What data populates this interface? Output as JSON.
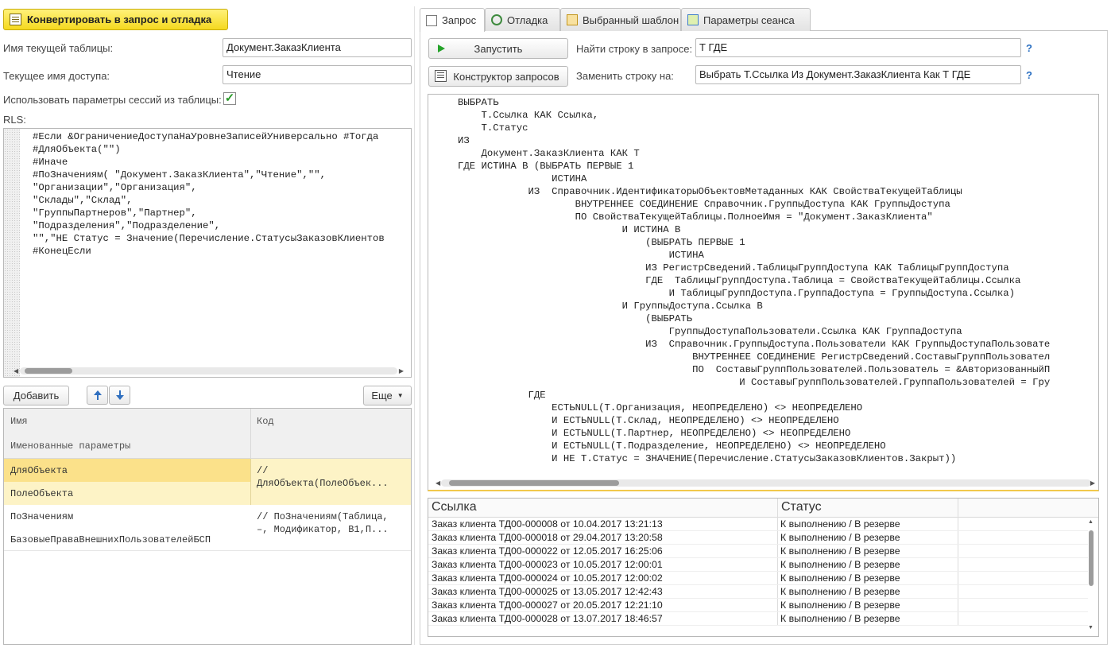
{
  "left": {
    "convert_button": "Конвертировать в запрос и отладка",
    "table_name_label": "Имя текущей таблицы:",
    "table_name_value": "Документ.ЗаказКлиента",
    "access_name_label": "Текущее имя доступа:",
    "access_name_value": "Чтение",
    "use_session_params_label": "Использовать параметры сессий из таблицы:",
    "use_session_params_checked": true,
    "rls_label": "RLS:",
    "rls_text": "#Если &ОграничениеДоступаНаУровнеЗаписейУниверсально #Тогда\n#ДляОбъекта(\"\")\n#Иначе\n#ПоЗначениям( \"Документ.ЗаказКлиента\",\"Чтение\",\"\",\n\"Организации\",\"Организация\",\n\"Склады\",\"Склад\",\n\"ГруппыПартнеров\",\"Партнер\",\n\"Подразделения\",\"Подразделение\",\n\"\",\"НЕ Статус = Значение(Перечисление.СтатусыЗаказовКлиентов\n#КонецЕсли",
    "add_button": "Добавить",
    "more_button": "Еще",
    "table": {
      "col_name": "Имя",
      "col_name_sub": "Именованные параметры",
      "col_code": "Код",
      "rows": [
        {
          "name": "ДляОбъекта",
          "name2": "ПолеОбъекта",
          "code1": "//",
          "code2": "ДляОбъекта(ПолеОбъек..."
        },
        {
          "name": "ПоЗначениям",
          "name2": "БазовыеПраваВнешнихПользователейБСП",
          "code1": "// ПоЗначениям(Таблица,",
          "code2": "–, Модификатор, В1,П..."
        }
      ]
    }
  },
  "right": {
    "tabs": [
      "Запрос",
      "Отладка",
      "Выбранный шаблон",
      "Параметры сеанса"
    ],
    "run_button": "Запустить",
    "constructor_button": "Конструктор запросов",
    "find_label": "Найти строку в запросе:",
    "find_value": "Т ГДЕ",
    "replace_label": "Заменить строку на:",
    "replace_value": "Выбрать Т.Ссылка Из Документ.ЗаказКлиента Как Т ГДЕ",
    "help": "?",
    "query_text": "ВЫБРАТЬ\n    Т.Ссылка КАК Ссылка,\n    Т.Статус\nИЗ\n    Документ.ЗаказКлиента КАК Т\nГДЕ ИСТИНА В (ВЫБРАТЬ ПЕРВЫЕ 1\n                ИСТИНА\n            ИЗ  Справочник.ИдентификаторыОбъектовМетаданных КАК СвойстваТекущейТаблицы\n                    ВНУТРЕННЕЕ СОЕДИНЕНИЕ Справочник.ГруппыДоступа КАК ГруппыДоступа\n                    ПО СвойстваТекущейТаблицы.ПолноеИмя = \"Документ.ЗаказКлиента\"\n                            И ИСТИНА В\n                                (ВЫБРАТЬ ПЕРВЫЕ 1\n                                    ИСТИНА\n                                ИЗ РегистрСведений.ТаблицыГруппДоступа КАК ТаблицыГруппДоступа\n                                ГДЕ  ТаблицыГруппДоступа.Таблица = СвойстваТекущейТаблицы.Ссылка\n                                    И ТаблицыГруппДоступа.ГруппаДоступа = ГруппыДоступа.Ссылка)\n                            И ГруппыДоступа.Ссылка В\n                                (ВЫБРАТЬ\n                                    ГруппыДоступаПользователи.Ссылка КАК ГруппаДоступа\n                                ИЗ  Справочник.ГруппыДоступа.Пользователи КАК ГруппыДоступаПользовате\n                                        ВНУТРЕННЕЕ СОЕДИНЕНИЕ РегистрСведений.СоставыГруппПользовател\n                                        ПО  СоставыГруппПользователей.Пользователь = &АвторизованныйП\n                                                И СоставыГруппПользователей.ГруппаПользователей = Гру\n            ГДЕ\n                ЕСТЬNULL(Т.Организация, НЕОПРЕДЕЛЕНО) <> НЕОПРЕДЕЛЕНО\n                И ЕСТЬNULL(Т.Склад, НЕОПРЕДЕЛЕНО) <> НЕОПРЕДЕЛЕНО\n                И ЕСТЬNULL(Т.Партнер, НЕОПРЕДЕЛЕНО) <> НЕОПРЕДЕЛЕНО\n                И ЕСТЬNULL(Т.Подразделение, НЕОПРЕДЕЛЕНО) <> НЕОПРЕДЕЛЕНО\n                И НЕ Т.Статус = ЗНАЧЕНИЕ(Перечисление.СтатусыЗаказовКлиентов.Закрыт))",
    "results": {
      "columns": [
        "Ссылка",
        "Статус"
      ],
      "rows": [
        [
          "Заказ клиента ТД00-000008 от 10.04.2017 13:21:13",
          "К выполнению / В резерве"
        ],
        [
          "Заказ клиента ТД00-000018 от 29.04.2017 13:20:58",
          "К выполнению / В резерве"
        ],
        [
          "Заказ клиента ТД00-000022 от 12.05.2017 16:25:06",
          "К выполнению / В резерве"
        ],
        [
          "Заказ клиента ТД00-000023 от 10.05.2017 12:00:01",
          "К выполнению / В резерве"
        ],
        [
          "Заказ клиента ТД00-000024 от 10.05.2017 12:00:02",
          "К выполнению / В резерве"
        ],
        [
          "Заказ клиента ТД00-000025 от 13.05.2017 12:42:43",
          "К выполнению / В резерве"
        ],
        [
          "Заказ клиента ТД00-000027 от 20.05.2017 12:21:10",
          "К выполнению / В резерве"
        ],
        [
          "Заказ клиента ТД00-000028 от 13.07.2017 18:46:57",
          "К выполнению / В резерве"
        ]
      ]
    }
  },
  "icons": [
    "document-edit-icon",
    "play-icon",
    "query-constructor-icon",
    "tab-query-icon",
    "tab-debug-icon",
    "tab-template-icon",
    "tab-session-icon",
    "arrow-up-icon",
    "arrow-down-icon",
    "checkmark-icon"
  ],
  "colors": {
    "accent_yellow": "#f5d91f",
    "selected_row": "#fbe89a",
    "link_blue": "#2a6fc2",
    "play_green": "#25a32a"
  }
}
